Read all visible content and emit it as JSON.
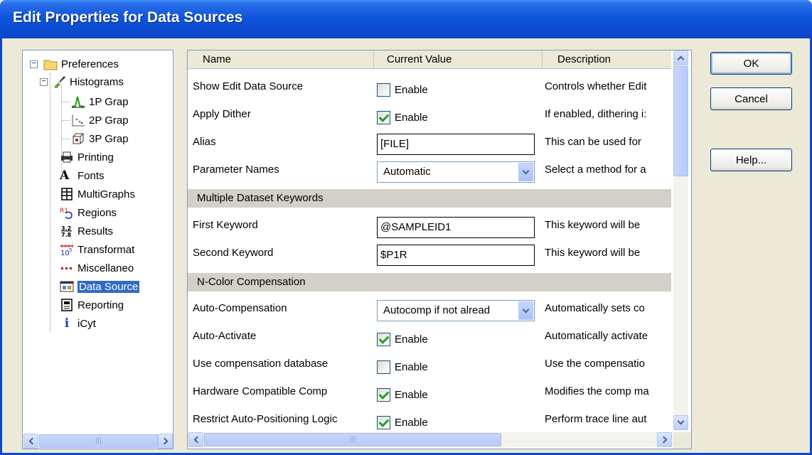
{
  "window": {
    "title": "Edit Properties for Data Sources"
  },
  "tree": {
    "items": [
      {
        "label": "Preferences",
        "icon": "folder-icon"
      },
      {
        "label": "Histograms",
        "icon": "brush-icon"
      },
      {
        "label": "1P Grap",
        "icon": "histogram-1p-icon"
      },
      {
        "label": "2P Grap",
        "icon": "dotplot-2p-icon"
      },
      {
        "label": "3P Grap",
        "icon": "cube-3p-icon"
      },
      {
        "label": "Printing",
        "icon": "printer-icon"
      },
      {
        "label": "Fonts",
        "icon": "font-icon"
      },
      {
        "label": "MultiGraphs",
        "icon": "grid-icon"
      },
      {
        "label": "Regions",
        "icon": "regions-icon"
      },
      {
        "label": "Results",
        "icon": "results-icon"
      },
      {
        "label": "Transformat",
        "icon": "transform-icon"
      },
      {
        "label": "Miscellaneo",
        "icon": "dots-icon"
      },
      {
        "label": "Data Source",
        "icon": "datasource-icon"
      },
      {
        "label": "Reporting",
        "icon": "report-icon"
      },
      {
        "label": "iCyt",
        "icon": "info-icon"
      }
    ]
  },
  "grid": {
    "headers": {
      "name": "Name",
      "value": "Current Value",
      "description": "Description"
    },
    "rows": [
      {
        "name": "Show Edit Data Source",
        "type": "checkbox",
        "checked": false,
        "label": "Enable",
        "desc": "Controls whether Edit"
      },
      {
        "name": "Apply Dither",
        "type": "checkbox",
        "checked": true,
        "label": "Enable",
        "desc": "If enabled, dithering i:"
      },
      {
        "name": "Alias",
        "type": "text",
        "value": "[FILE]",
        "desc": "This can be used for"
      },
      {
        "name": "Parameter Names",
        "type": "combo",
        "value": "Automatic",
        "desc": "Select a method for a"
      },
      {
        "section": "Multiple Dataset Keywords"
      },
      {
        "name": "First Keyword",
        "type": "text",
        "value": "@SAMPLEID1",
        "desc": "This keyword will be"
      },
      {
        "name": "Second Keyword",
        "type": "text",
        "value": "$P1R",
        "desc": "This keyword will be"
      },
      {
        "section": "N-Color Compensation"
      },
      {
        "name": "Auto-Compensation",
        "type": "combo",
        "value": "Autocomp if not alread",
        "desc": "Automatically sets co"
      },
      {
        "name": "Auto-Activate",
        "type": "checkbox",
        "checked": true,
        "label": "Enable",
        "desc": "Automatically activate"
      },
      {
        "name": "Use compensation database",
        "type": "checkbox",
        "checked": false,
        "label": "Enable",
        "desc": "Use the compensatio"
      },
      {
        "name": "Hardware Compatible Comp",
        "type": "checkbox",
        "checked": true,
        "label": "Enable",
        "desc": "Modifies the comp ma"
      },
      {
        "name": "Restrict Auto-Positioning Logic",
        "type": "checkbox",
        "checked": true,
        "label": "Enable",
        "desc": "Perform trace line aut"
      }
    ]
  },
  "buttons": {
    "ok": "OK",
    "cancel": "Cancel",
    "help": "Help..."
  }
}
